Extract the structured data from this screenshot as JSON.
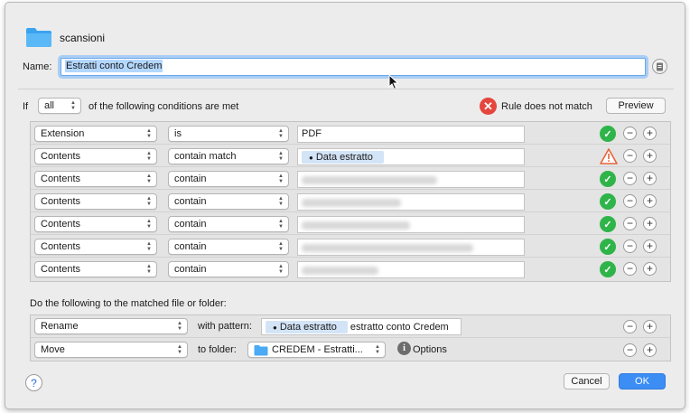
{
  "folder": {
    "name": "scansioni",
    "icon": "folder-icon"
  },
  "name_field": {
    "label": "Name:",
    "value": "Estratti conto Credem"
  },
  "conditions": {
    "if_label": "If",
    "quantifier": "all",
    "suffix": "of the following conditions are met",
    "status_text": "Rule does not match",
    "status_color": "#e5463d",
    "preview_label": "Preview",
    "rows": [
      {
        "attribute": "Extension",
        "operator": "is",
        "value": "PDF",
        "status": "ok"
      },
      {
        "attribute": "Contents",
        "operator": "contain match",
        "token": "Data estratto",
        "status": "warning"
      },
      {
        "attribute": "Contents",
        "operator": "contain",
        "value": "",
        "status": "ok"
      },
      {
        "attribute": "Contents",
        "operator": "contain",
        "value": "",
        "status": "ok"
      },
      {
        "attribute": "Contents",
        "operator": "contain",
        "value": "",
        "status": "ok"
      },
      {
        "attribute": "Contents",
        "operator": "contain",
        "value": "",
        "status": "ok"
      },
      {
        "attribute": "Contents",
        "operator": "contain",
        "value": "",
        "status": "ok"
      }
    ]
  },
  "actions": {
    "label": "Do the following to the matched file or folder:",
    "rows": [
      {
        "action": "Rename",
        "connector": "with pattern:",
        "token": "Data estratto",
        "pattern_text": "estratto conto Credem"
      },
      {
        "action": "Move",
        "connector": "to folder:",
        "folder": "CREDEM - Estratti...",
        "options_label": "Options"
      }
    ]
  },
  "footer": {
    "cancel_label": "Cancel",
    "ok_label": "OK",
    "help_label": "?"
  },
  "colors": {
    "accent": "#3c8df4",
    "ok_green": "#2fb44a",
    "warning_orange": "#e8643a",
    "token_bg": "#d3e4f7"
  }
}
